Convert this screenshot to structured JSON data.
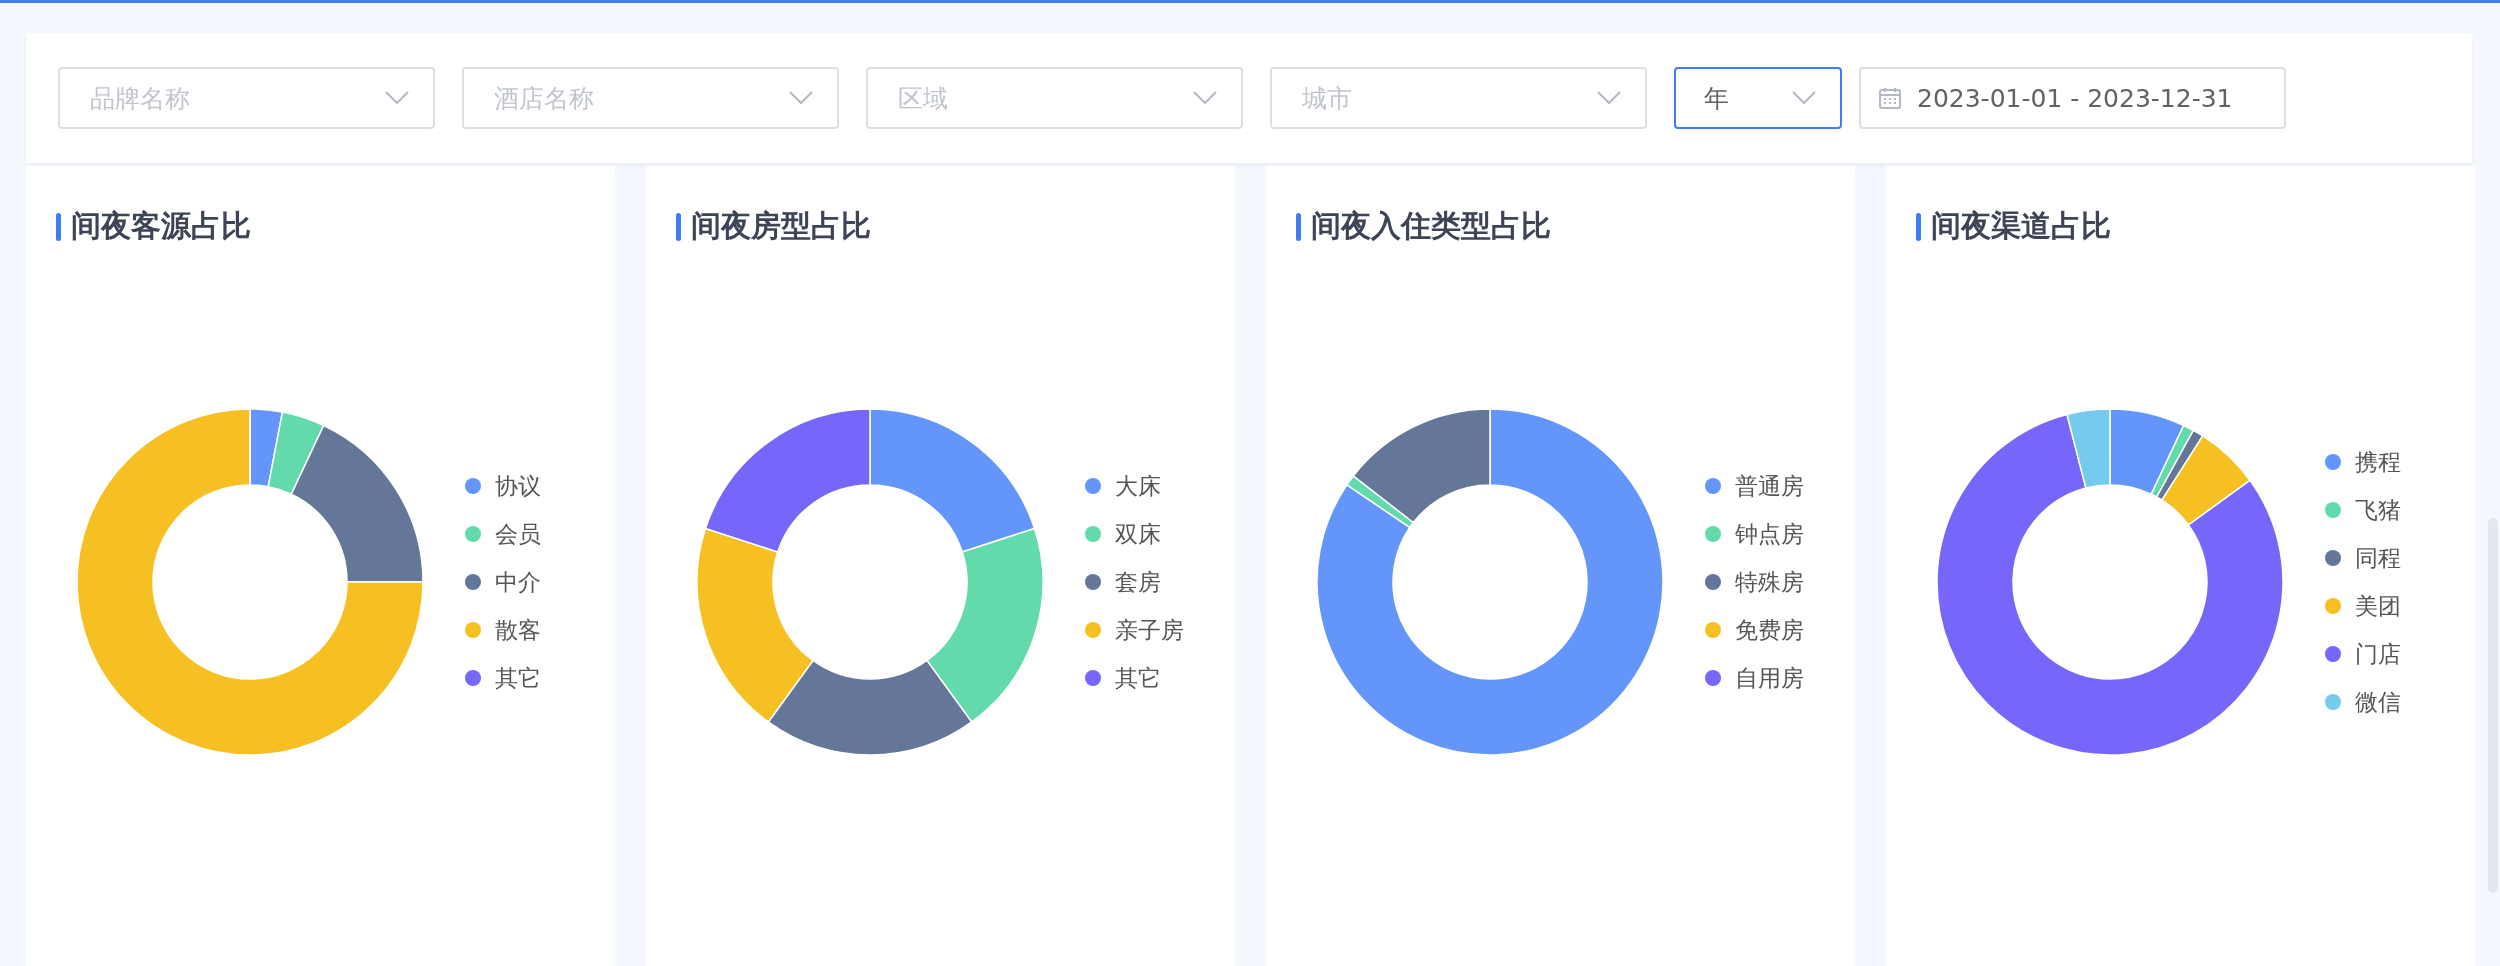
{
  "filters": [
    {
      "kind": "select",
      "placeholder": "品牌名称",
      "focused": false
    },
    {
      "kind": "select",
      "placeholder": "酒店名称",
      "focused": false
    },
    {
      "kind": "select",
      "placeholder": "区域",
      "focused": false
    },
    {
      "kind": "select",
      "placeholder": "城市",
      "focused": false
    },
    {
      "kind": "select",
      "value": "年",
      "focused": true
    },
    {
      "kind": "date_range",
      "value": "2023-01-01 - 2023-12-31",
      "focused": false
    }
  ],
  "cards": [
    {
      "title": "间夜客源占比",
      "legend": [
        {
          "label": "协议",
          "color": "#6395fa"
        },
        {
          "label": "会员",
          "color": "#62daab"
        },
        {
          "label": "中介",
          "color": "#657798"
        },
        {
          "label": "散客",
          "color": "#f6c022"
        },
        {
          "label": "其它",
          "color": "#7666f9"
        }
      ]
    },
    {
      "title": "间夜房型占比",
      "legend": [
        {
          "label": "大床",
          "color": "#6395fa"
        },
        {
          "label": "双床",
          "color": "#62daab"
        },
        {
          "label": "套房",
          "color": "#657798"
        },
        {
          "label": "亲子房",
          "color": "#f6c022"
        },
        {
          "label": "其它",
          "color": "#7666f9"
        }
      ]
    },
    {
      "title": "间夜入住类型占比",
      "legend": [
        {
          "label": "普通房",
          "color": "#6395fa"
        },
        {
          "label": "钟点房",
          "color": "#62daab"
        },
        {
          "label": "特殊房",
          "color": "#657798"
        },
        {
          "label": "免费房",
          "color": "#f6c022"
        },
        {
          "label": "自用房",
          "color": "#7666f9"
        }
      ]
    },
    {
      "title": "间夜渠道占比",
      "legend": [
        {
          "label": "携程",
          "color": "#6395fa"
        },
        {
          "label": "飞猪",
          "color": "#62daab"
        },
        {
          "label": "同程",
          "color": "#657798"
        },
        {
          "label": "美团",
          "color": "#f6c022"
        },
        {
          "label": "门店",
          "color": "#7666f9"
        },
        {
          "label": "微信",
          "color": "#74cbed"
        }
      ]
    }
  ]
}
